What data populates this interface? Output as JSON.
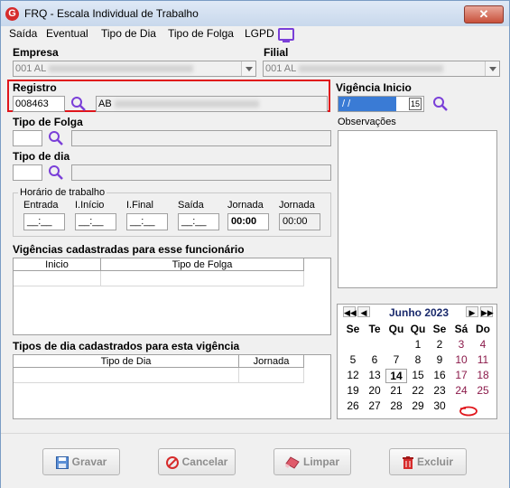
{
  "window": {
    "title": "FRQ - Escala Individual de Trabalho",
    "close_label": "✕"
  },
  "menu": [
    {
      "label": "Saída"
    },
    {
      "label": "Eventual"
    },
    {
      "label": "Tipo de Dia"
    },
    {
      "label": "Tipo de Folga"
    },
    {
      "label": "LGPD"
    }
  ],
  "empresa": {
    "label": "Empresa",
    "value": "001 AL"
  },
  "filial": {
    "label": "Filial",
    "value": "001 AL"
  },
  "registro": {
    "label": "Registro",
    "code": "008463",
    "name": "AB"
  },
  "vigencia_inicio": {
    "label": "Vigência Inicio",
    "value": "/ /",
    "date_button": "15"
  },
  "observacoes": {
    "label": "Observações",
    "value": ""
  },
  "tipo_folga": {
    "label": "Tipo de Folga",
    "code": "",
    "desc": ""
  },
  "tipo_dia": {
    "label": "Tipo de dia",
    "code": "",
    "desc": ""
  },
  "horario": {
    "title": "Horário de trabalho",
    "fields": [
      {
        "label": "Entrada",
        "value": "__:__"
      },
      {
        "label": "I.Início",
        "value": "__:__"
      },
      {
        "label": "I.Final",
        "value": "__:__"
      },
      {
        "label": "Saída",
        "value": "__:__"
      },
      {
        "label": "Jornada",
        "value": "00:00"
      },
      {
        "label": "Jornada",
        "value": "00:00"
      }
    ]
  },
  "vigencias_grid": {
    "title": "Vigências cadastradas para esse funcionário",
    "columns": [
      "Inicio",
      "Tipo de Folga"
    ]
  },
  "tipos_dia_grid": {
    "title": "Tipos de dia cadastrados para esta vigência",
    "columns": [
      "Tipo de Dia",
      "Jornada"
    ]
  },
  "calendar": {
    "month": "Junho 2023",
    "nav": [
      "◀◀",
      "◀",
      "▶",
      "▶▶"
    ],
    "weekdays": [
      "Se",
      "Te",
      "Qu",
      "Qu",
      "Se",
      "Sá",
      "Do"
    ],
    "weeks": [
      [
        "",
        "",
        "",
        "1",
        "2",
        "3",
        "4"
      ],
      [
        "5",
        "6",
        "7",
        "8",
        "9",
        "10",
        "11"
      ],
      [
        "12",
        "13",
        "14",
        "15",
        "16",
        "17",
        "18"
      ],
      [
        "19",
        "20",
        "21",
        "22",
        "23",
        "24",
        "25"
      ],
      [
        "26",
        "27",
        "28",
        "29",
        "30",
        "",
        ""
      ]
    ],
    "today": "14",
    "weekend_color": "#8b1a4a"
  },
  "buttons": {
    "save": "Gravar",
    "cancel": "Cancelar",
    "clear": "Limpar",
    "delete": "Excluir"
  },
  "colors": {
    "highlight": "#e0151b",
    "accent": "#7a3fd8",
    "calendar_month": "#1a2a6c"
  }
}
